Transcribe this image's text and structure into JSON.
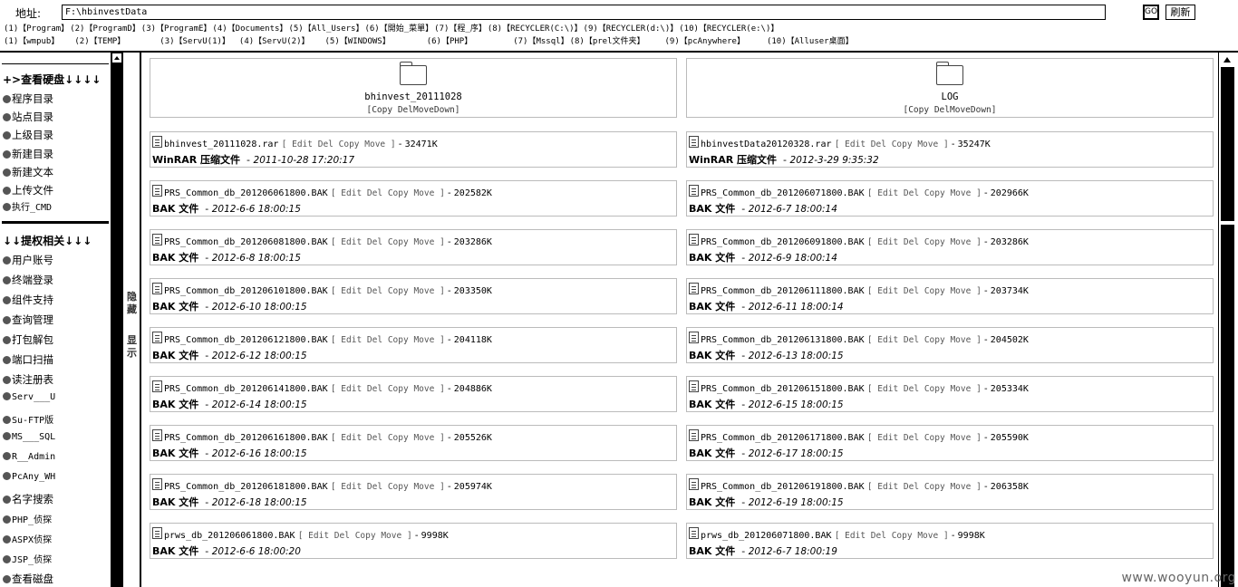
{
  "address": {
    "label": "地址:",
    "value": "F:\\hbinvestData",
    "go_label": "GO",
    "refresh_label": "刷新"
  },
  "quick_links_row1": [
    "(1)【Program】",
    "(2)【ProgramD】",
    "(3)【ProgramE】",
    "(4)【Documents】",
    "(5)【All_Users】",
    "(6)【開始_菜單】",
    "(7)【程_序】",
    "(8)【RECYCLER(C:\\)】",
    "(9)【RECYCLER(d:\\)】",
    "(10)【RECYCLER(e:\\)】"
  ],
  "quick_links_row2": [
    "(1)【wmpub】",
    "(2)【TEMP】",
    "(3)【ServU(1)】",
    "(4)【ServU(2)】",
    "(5)【WINDOWS】",
    "(6)【PHP】",
    "(7)【Mssql】",
    "(8)【prel文件夹】",
    "(9)【pcAnywhere】",
    "(10)【Alluser桌面】"
  ],
  "sidebar": {
    "disk_heading": "+>查看硬盘↓↓↓↓",
    "disk_items": [
      "程序目录",
      "站点目录",
      "上级目录",
      "新建目录",
      "新建文本",
      "上传文件"
    ],
    "cmd_item": "执行_CMD",
    "priv_heading": "↓↓提权相关↓↓↓",
    "priv_items": [
      "用户账号",
      "终端登录",
      "组件支持",
      "查询管理",
      "打包解包",
      "端口扫描",
      "读注册表"
    ],
    "priv_items_mono": [
      "Serv___U",
      "Su-FTP版",
      "MS___SQL",
      "R__Admin",
      "PcAny_WH"
    ],
    "priv_items2": [
      "名字搜索"
    ],
    "priv_items2_mono": [
      "PHP_侦探",
      "ASPX侦探",
      "JSP_侦探"
    ],
    "priv_items3": [
      "查看磁盘"
    ]
  },
  "toggle": {
    "hide": "隐藏",
    "show": "显示"
  },
  "folders": [
    {
      "name": "bhinvest_20111028",
      "actions": [
        "[",
        "Copy",
        " ",
        "Del",
        "Move",
        "Down",
        "]"
      ]
    },
    {
      "name": "LOG",
      "actions": [
        "[",
        "Copy",
        " ",
        "Del",
        "Move",
        "Down",
        "]"
      ]
    }
  ],
  "file_actions": {
    "edit": "Edit",
    "del": "Del",
    "copy": "Copy",
    "move": "Move",
    "open": "[",
    "close": "]",
    "dash": "-"
  },
  "files": [
    {
      "name": "bhinvest_20111028.rar",
      "size": "32471K",
      "type": "WinRAR 压缩文件",
      "date": "2011-10-28 17:20:17"
    },
    {
      "name": "hbinvestData20120328.rar",
      "size": "35247K",
      "type": "WinRAR 压缩文件",
      "date": "2012-3-29 9:35:32"
    },
    {
      "name": "PRS_Common_db_201206061800.BAK",
      "size": "202582K",
      "type": "BAK 文件",
      "date": "2012-6-6 18:00:15"
    },
    {
      "name": "PRS_Common_db_201206071800.BAK",
      "size": "202966K",
      "type": "BAK 文件",
      "date": "2012-6-7 18:00:14"
    },
    {
      "name": "PRS_Common_db_201206081800.BAK",
      "size": "203286K",
      "type": "BAK 文件",
      "date": "2012-6-8 18:00:15"
    },
    {
      "name": "PRS_Common_db_201206091800.BAK",
      "size": "203286K",
      "type": "BAK 文件",
      "date": "2012-6-9 18:00:14"
    },
    {
      "name": "PRS_Common_db_201206101800.BAK",
      "size": "203350K",
      "type": "BAK 文件",
      "date": "2012-6-10 18:00:15"
    },
    {
      "name": "PRS_Common_db_201206111800.BAK",
      "size": "203734K",
      "type": "BAK 文件",
      "date": "2012-6-11 18:00:14"
    },
    {
      "name": "PRS_Common_db_201206121800.BAK",
      "size": "204118K",
      "type": "BAK 文件",
      "date": "2012-6-12 18:00:15"
    },
    {
      "name": "PRS_Common_db_201206131800.BAK",
      "size": "204502K",
      "type": "BAK 文件",
      "date": "2012-6-13 18:00:15"
    },
    {
      "name": "PRS_Common_db_201206141800.BAK",
      "size": "204886K",
      "type": "BAK 文件",
      "date": "2012-6-14 18:00:15"
    },
    {
      "name": "PRS_Common_db_201206151800.BAK",
      "size": "205334K",
      "type": "BAK 文件",
      "date": "2012-6-15 18:00:15"
    },
    {
      "name": "PRS_Common_db_201206161800.BAK",
      "size": "205526K",
      "type": "BAK 文件",
      "date": "2012-6-16 18:00:15"
    },
    {
      "name": "PRS_Common_db_201206171800.BAK",
      "size": "205590K",
      "type": "BAK 文件",
      "date": "2012-6-17 18:00:15"
    },
    {
      "name": "PRS_Common_db_201206181800.BAK",
      "size": "205974K",
      "type": "BAK 文件",
      "date": "2012-6-18 18:00:15"
    },
    {
      "name": "PRS_Common_db_201206191800.BAK",
      "size": "206358K",
      "type": "BAK 文件",
      "date": "2012-6-19 18:00:15"
    },
    {
      "name": "prws_db_201206061800.BAK",
      "size": "9998K",
      "type": "BAK 文件",
      "date": "2012-6-6 18:00:20"
    },
    {
      "name": "prws_db_201206071800.BAK",
      "size": "9998K",
      "type": "BAK 文件",
      "date": "2012-6-7 18:00:19"
    }
  ],
  "watermark": "www.wooyun.org"
}
